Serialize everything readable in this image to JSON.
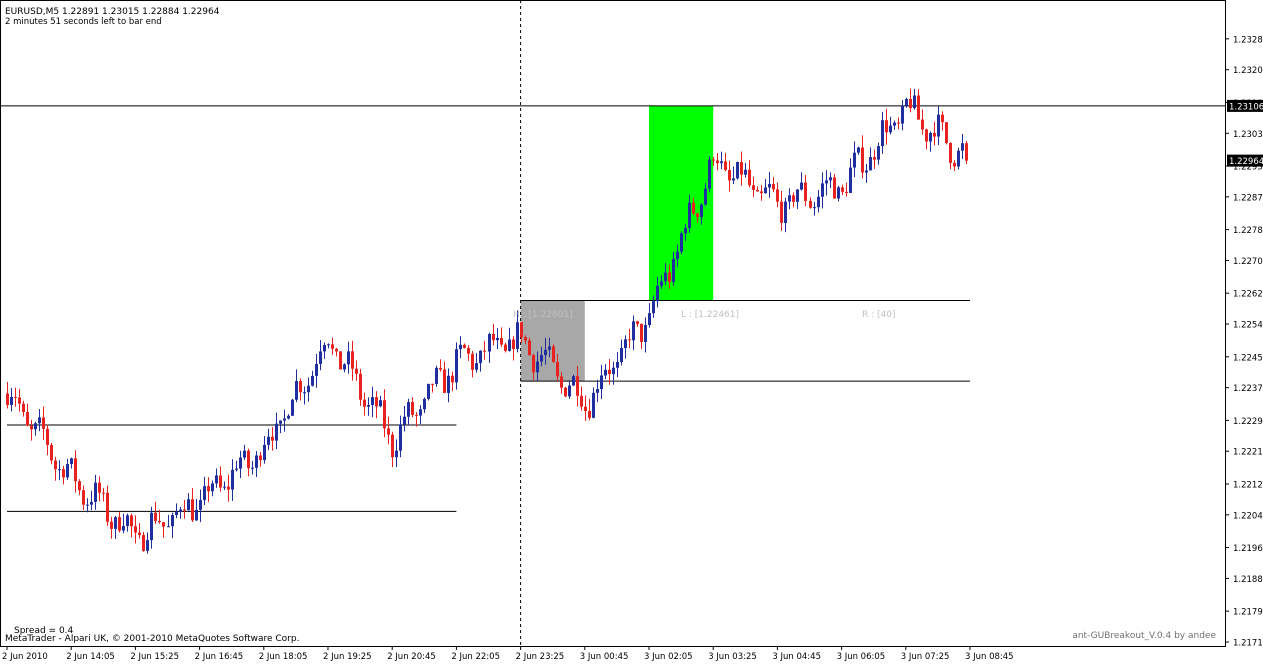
{
  "header": {
    "title_line": "EURUSD,M5  1.22891 1.23015 1.22884 1.22964",
    "timer_text": "2 minutes 51 seconds left to bar end"
  },
  "footer": {
    "spread_text": "Spread  =    0.4",
    "copyright_text": "MetaTrader - Alpari UK, © 2001-2010 MetaQuotes Software Corp.",
    "indicator_text": "ant-GUBreakout_V.0.4 by andee"
  },
  "colors": {
    "background": "#ffffff",
    "bull_candle": "#1f2f9f",
    "bear_candle": "#e8231f",
    "breakout_box": "#00ff00",
    "range_box": "#a8a8a8",
    "lines": "#000000",
    "range_labels": "#c0c0c0",
    "price_tag_bg": "#000000",
    "price_tag_text": "#ffffff"
  },
  "annotations": {
    "high_label": "H : [1.22601]",
    "low_label": "L : [1.22461]",
    "range_label": "R : [40]"
  },
  "chart_data": {
    "type": "candlestick",
    "symbol": "EURUSD",
    "timeframe": "M5",
    "ohlc_current": {
      "open": 1.22891,
      "high": 1.23015,
      "low": 1.22884,
      "close": 1.22964
    },
    "ylim": [
      1.21715,
      1.2336
    ],
    "y_ticks": [
      "1.23280",
      "1.23200",
      "1.23115",
      "1.23035",
      "1.22950",
      "1.22870",
      "1.22785",
      "1.22705",
      "1.22620",
      "1.22540",
      "1.22455",
      "1.22375",
      "1.22290",
      "1.22210",
      "1.22125",
      "1.22045",
      "1.21960",
      "1.21880",
      "1.21795",
      "1.21715"
    ],
    "x_ticks": [
      "2 Jun 2010",
      "2 Jun 14:05",
      "2 Jun 15:25",
      "2 Jun 16:45",
      "2 Jun 18:05",
      "2 Jun 19:25",
      "2 Jun 20:45",
      "2 Jun 22:05",
      "2 Jun 23:25",
      "3 Jun 00:45",
      "3 Jun 02:05",
      "3 Jun 03:25",
      "3 Jun 04:45",
      "3 Jun 06:05",
      "3 Jun 07:25",
      "3 Jun 08:45"
    ],
    "bar_minutes": 5,
    "hlines_full": [
      1.23106
    ],
    "hlines_partial": [
      {
        "price": 1.22278,
        "from": "2 Jun 2010",
        "to": "2 Jun 22:05"
      },
      {
        "price": 1.22054,
        "from": "2 Jun 2010",
        "to": "2 Jun 22:05"
      },
      {
        "price": 1.22601,
        "from": "2 Jun 23:25",
        "to": "3 Jun 08:45"
      },
      {
        "price": 1.22392,
        "from": "2 Jun 23:25",
        "to": "3 Jun 08:45"
      }
    ],
    "session_separator": "2 Jun 23:25",
    "range_box": {
      "from": "2 Jun 23:25",
      "to": "3 Jun 00:45",
      "high": 1.22601,
      "low": 1.22392
    },
    "breakout_box": {
      "from": "3 Jun 02:05",
      "to": "3 Jun 03:25",
      "high": 1.23106,
      "low": 1.22601
    },
    "price_tags": [
      {
        "price": 1.23106,
        "label": "1.23106"
      },
      {
        "price": 1.22964,
        "label": "1.22964"
      }
    ],
    "close_path": [
      [
        "2 Jun 2010",
        1.2236
      ],
      [
        "2 Jun 14:05",
        1.2214
      ],
      [
        "2 Jun 15:25",
        1.2199
      ],
      [
        "2 Jun 16:45",
        1.2208
      ],
      [
        "2 Jun 18:05",
        1.2222
      ],
      [
        "2 Jun 19:25",
        1.225
      ],
      [
        "2 Jun 20:45",
        1.2224
      ],
      [
        "2 Jun 22:05",
        1.2244
      ],
      [
        "2 Jun 23:25",
        1.225
      ],
      [
        "3 Jun 00:45",
        1.2234
      ],
      [
        "3 Jun 02:05",
        1.2256
      ],
      [
        "3 Jun 03:25",
        1.2296
      ],
      [
        "3 Jun 04:45",
        1.2285
      ],
      [
        "3 Jun 06:05",
        1.229
      ],
      [
        "3 Jun 07:25",
        1.231
      ],
      [
        "3 Jun 08:45",
        1.22964
      ]
    ],
    "grid": false,
    "legend": "none"
  }
}
